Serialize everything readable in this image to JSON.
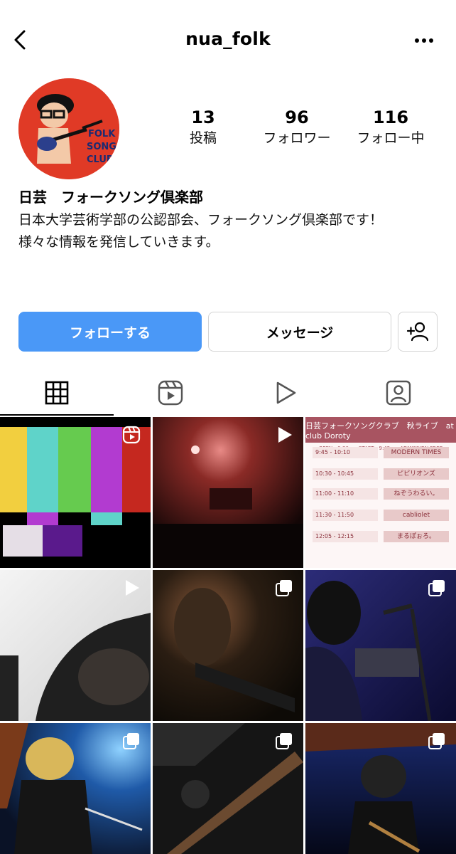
{
  "header": {
    "username": "nua_folk"
  },
  "profile": {
    "stats": [
      {
        "value": "13",
        "label": "投稿"
      },
      {
        "value": "96",
        "label": "フォロワー"
      },
      {
        "value": "116",
        "label": "フォロー中"
      }
    ],
    "name": "日芸　フォークソング倶楽部",
    "bio": [
      "日本大学芸術学部の公認部会、フォークソング倶楽部です！",
      "様々な情報を発信していきます。"
    ],
    "avatar_text": [
      "FOLK",
      "SONG",
      "CLUB"
    ]
  },
  "actions": {
    "follow_label": "フォローする",
    "message_label": "メッセージ"
  },
  "tabs": [
    "grid",
    "reels",
    "videos",
    "tagged"
  ],
  "posts": {
    "schedule_post": {
      "title": "日芸フォークソングクラブ　秋ライブ　at club Doroty",
      "subtitle": "OPEN - 9:30　　START - 9:45　　ADMISSION FREE",
      "rows": [
        {
          "time": "9:45 - 10:10",
          "band": "MODERN TIMES"
        },
        {
          "time": "10:30 - 10:45",
          "band": "ピピリオンズ"
        },
        {
          "time": "11:00 - 11:10",
          "band": "ねぞうわるい。"
        },
        {
          "time": "11:30 - 11:50",
          "band": "cabliolet"
        },
        {
          "time": "12:05 - 12:15",
          "band": "まるぽぉろ。"
        }
      ]
    }
  },
  "colors": {
    "accent_blue": "#4a98f7",
    "avatar_red": "#e03a26"
  }
}
